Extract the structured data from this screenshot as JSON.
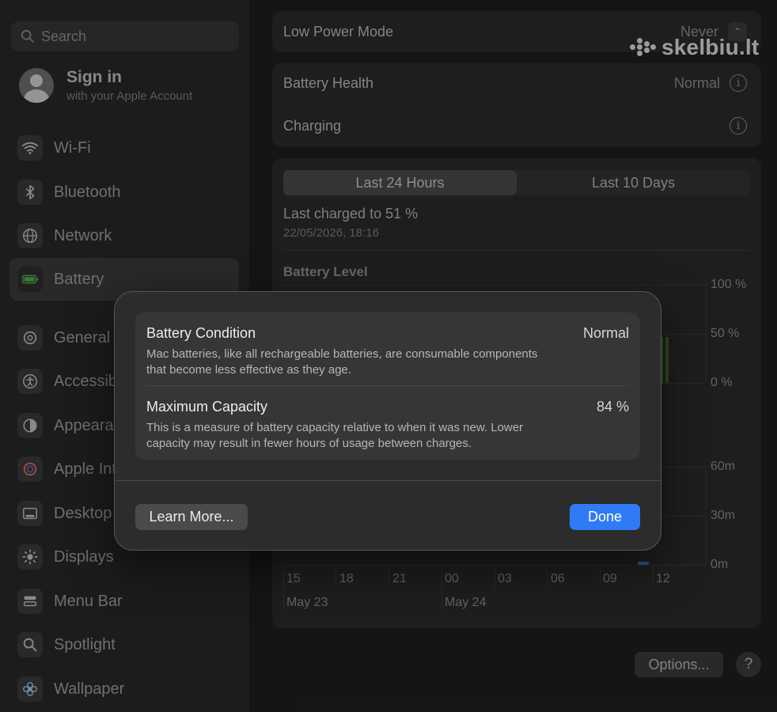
{
  "sidebar": {
    "search_placeholder": "Search",
    "account": {
      "name": "Sign in",
      "subtitle": "with your Apple Account"
    },
    "items": [
      {
        "label": "Wi-Fi",
        "icon": "wifi-icon"
      },
      {
        "label": "Bluetooth",
        "icon": "bluetooth-icon"
      },
      {
        "label": "Network",
        "icon": "globe-icon"
      },
      {
        "label": "Battery",
        "icon": "battery-icon",
        "active": true
      },
      {
        "label": "General",
        "icon": "gear-icon"
      },
      {
        "label": "Accessibility",
        "icon": "accessibility-icon"
      },
      {
        "label": "Appearance",
        "icon": "appearance-icon"
      },
      {
        "label": "Apple Intelligence & Siri",
        "icon": "siri-icon"
      },
      {
        "label": "Desktop & Dock",
        "icon": "dock-icon"
      },
      {
        "label": "Displays",
        "icon": "sun-icon"
      },
      {
        "label": "Menu Bar",
        "icon": "menubar-icon"
      },
      {
        "label": "Spotlight",
        "icon": "magnifier-icon"
      },
      {
        "label": "Wallpaper",
        "icon": "flower-icon"
      }
    ]
  },
  "settings": {
    "low_power_label": "Low Power Mode",
    "low_power_value": "Never",
    "battery_health_label": "Battery Health",
    "battery_health_value": "Normal",
    "charging_label": "Charging"
  },
  "usage": {
    "tabs": [
      "Last 24 Hours",
      "Last 10 Days"
    ],
    "selected_tab": 0,
    "last_charged": "Last charged to 51 %",
    "last_charged_date": "22/05/2026, 18:16",
    "chart_title": "Battery Level"
  },
  "chart_data": {
    "type": "bar",
    "title": "Battery Level",
    "y_ticks_level": [
      "100 %",
      "50 %",
      "0 %"
    ],
    "y_ticks_usage": [
      "60m",
      "30m",
      "0m"
    ],
    "x_ticks": [
      "15",
      "18",
      "21",
      "00",
      "03",
      "06",
      "09",
      "12"
    ],
    "date_labels": [
      "May 23",
      "May 24"
    ],
    "accent_color": "#3e6b2e"
  },
  "footer": {
    "options_label": "Options...",
    "help_label": "?"
  },
  "watermark": "skelbiu.lt",
  "modal": {
    "condition_title": "Battery Condition",
    "condition_value": "Normal",
    "condition_desc": "Mac batteries, like all rechargeable batteries, are consumable components that become less effective as they age.",
    "capacity_title": "Maximum Capacity",
    "capacity_value": "84 %",
    "capacity_desc": "This is a measure of battery capacity relative to when it was new. Lower capacity may result in fewer hours of usage between charges.",
    "learn_more_label": "Learn More...",
    "done_label": "Done"
  },
  "colors": {
    "accent": "#2f7bf5",
    "battery_green": "#3e6b2e"
  }
}
